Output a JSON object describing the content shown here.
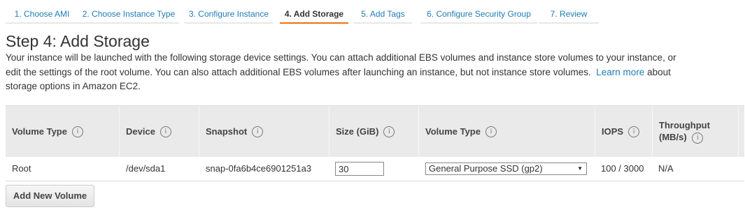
{
  "wizard": {
    "steps": [
      {
        "label": "1. Choose AMI",
        "active": false
      },
      {
        "label": "2. Choose Instance Type",
        "active": false
      },
      {
        "label": "3. Configure Instance",
        "active": false
      },
      {
        "label": "4. Add Storage",
        "active": true
      },
      {
        "label": "5. Add Tags",
        "active": false
      },
      {
        "label": "6. Configure Security Group",
        "active": false
      },
      {
        "label": "7. Review",
        "active": false
      }
    ]
  },
  "page": {
    "title": "Step 4: Add Storage",
    "description_before": "Your instance will be launched with the following storage device settings. You can attach additional EBS volumes and instance store volumes to your instance, or edit the settings of the root volume. You can also attach additional EBS volumes after launching an instance, but not instance store volumes.",
    "learn_more": "Learn more",
    "description_after": "about storage options in Amazon EC2."
  },
  "table": {
    "headers": {
      "volume_type": "Volume Type",
      "device": "Device",
      "snapshot": "Snapshot",
      "size": "Size (GiB)",
      "volume_type_select": "Volume Type",
      "iops": "IOPS",
      "throughput": "Throughput (MB/s)"
    },
    "info_icon": "i",
    "row": {
      "volume_type": "Root",
      "device": "/dev/sda1",
      "snapshot": "snap-0fa6b4ce6901251a3",
      "size": "30",
      "volume_type_select": "General Purpose SSD (gp2)",
      "iops": "100 / 3000",
      "throughput": "N/A"
    }
  },
  "add_volume_button": "Add New Volume",
  "colors": {
    "link": "#1f7cb6",
    "active_tab_underline": "#ec7211",
    "header_bg": "#eaeaea"
  },
  "icons": {
    "info": "info-circle-icon",
    "select_arrow": "triangle-down-icon"
  }
}
